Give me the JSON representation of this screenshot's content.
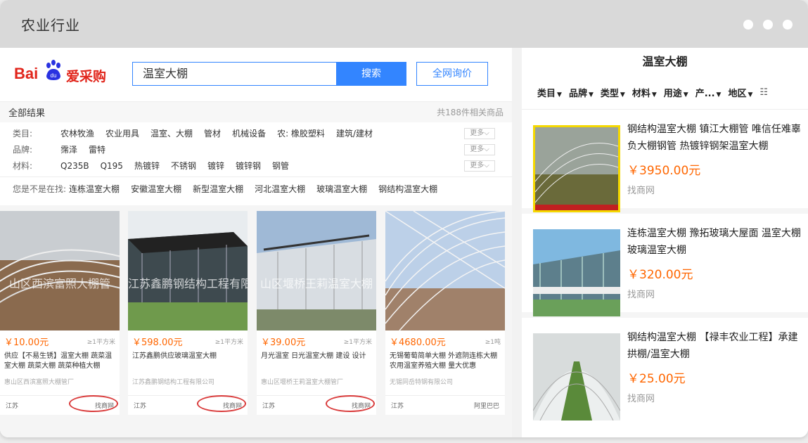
{
  "window": {
    "title": "农业行业"
  },
  "search": {
    "logo_bai": "Bai",
    "logo_du": "du",
    "logo_brand": "爱采购",
    "query": "温室大棚",
    "search_button": "搜索",
    "all_button": "全网询价"
  },
  "results": {
    "label": "全部结果",
    "count": "共188件相关商品"
  },
  "filters": [
    {
      "label": "类目:",
      "items": [
        "农林牧渔",
        "农业用具",
        "温室、大棚",
        "管材",
        "机械设备",
        "农: 橡胶塑料",
        "建筑/建材"
      ],
      "more": "更多"
    },
    {
      "label": "品牌:",
      "items": [
        "霈泽",
        "雷特"
      ],
      "more": "更多"
    },
    {
      "label": "材料:",
      "items": [
        "Q235B",
        "Q195",
        "热镀锌",
        "不锈钢",
        "镀锌",
        "镀锌钢",
        "钢管"
      ],
      "more": "更多"
    }
  ],
  "suggest": {
    "label": "您是不是在找:",
    "items": [
      "连栋温室大棚",
      "安徽温室大棚",
      "新型温室大棚",
      "河北温室大棚",
      "玻璃温室大棚",
      "钢结构温室大棚"
    ]
  },
  "cards": [
    {
      "watermark": "山区西滨富照大棚管",
      "price": "￥10.00元",
      "unit": "≥1平方米",
      "title": "供应【不易生锈】温室大棚 蔬菜温室大棚 蔬菜大棚 蔬菜种植大棚",
      "company": "惠山区西滨富照大棚管厂",
      "region": "江苏",
      "source": "找商网"
    },
    {
      "watermark": "江苏鑫鹏钢结构工程有限",
      "price": "￥598.00元",
      "unit": "≥1平方米",
      "title": "江苏鑫鹏供应玻璃温室大棚",
      "company": "江苏鑫鹏钢结构工程有限公司",
      "region": "江苏",
      "source": "找商网"
    },
    {
      "watermark": "山区堰桥王莉温室大棚",
      "price": "￥39.00元",
      "unit": "≥1平方米",
      "title": "月光温室 日光温室大棚 建设 设计",
      "company": "惠山区堰桥王莉温室大棚管厂",
      "region": "江苏",
      "source": "找商网"
    },
    {
      "watermark": "",
      "price": "￥4680.00元",
      "unit": "≥1吨",
      "title": "无锡葡萄简单大棚 外遮阴连栋大棚 农用温室养殖大棚 量大优惠",
      "company": "无锡同岳特钢有限公司",
      "region": "江苏",
      "source": "阿里巴巴"
    }
  ],
  "right": {
    "title": "温室大棚",
    "tabs": [
      "类目",
      "品牌",
      "类型",
      "材料",
      "用途",
      "产...",
      "地区"
    ],
    "items": [
      {
        "title": "钢结构温室大棚 镇江大棚管 唯信任难辜负大棚钢管 热镀锌钢架温室大棚",
        "price": "￥3950.00元",
        "source": "找商网"
      },
      {
        "title": "连栋温室大棚 豫拓玻璃大屋面 温室大棚 玻璃温室大棚",
        "price": "￥320.00元",
        "source": "找商网"
      },
      {
        "title": "钢结构温室大棚 【禄丰农业工程】承建拱棚/温室大棚",
        "price": "￥25.00元",
        "source": "找商网"
      }
    ]
  },
  "colors": {
    "accent": "#3385ff",
    "price": "#ff6600",
    "brand": "#e1251b",
    "highlight": "#d93a3a"
  }
}
